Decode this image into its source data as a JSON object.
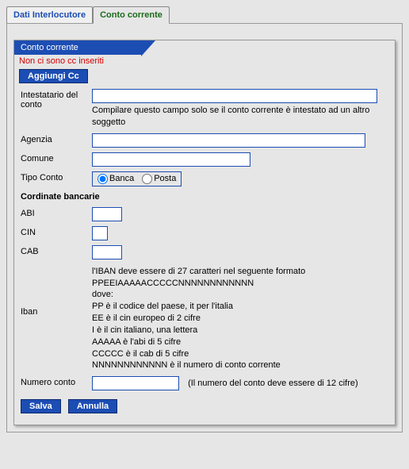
{
  "tabs": {
    "inactive": "Dati Interlocutore",
    "active": "Conto corrente"
  },
  "section": {
    "title": "Conto corrente"
  },
  "error": "Non ci sono cc inseriti",
  "buttons": {
    "add": "Aggiungi Cc",
    "save": "Salva",
    "cancel": "Annulla"
  },
  "form": {
    "intestatario": {
      "label": "Intestatario del conto",
      "value": "",
      "hint": "Compilare questo campo solo se il conto corrente è intestato ad un altro soggetto"
    },
    "agenzia": {
      "label": "Agenzia",
      "value": ""
    },
    "comune": {
      "label": "Comune",
      "value": ""
    },
    "tipoConto": {
      "label": "Tipo Conto",
      "options": {
        "banca": "Banca",
        "posta": "Posta"
      },
      "selected": "banca"
    },
    "coordinate": {
      "heading": "Cordinate bancarie"
    },
    "abi": {
      "label": "ABI",
      "value": ""
    },
    "cin": {
      "label": "CIN",
      "value": ""
    },
    "cab": {
      "label": "CAB",
      "value": ""
    },
    "iban": {
      "label": "Iban",
      "value": "",
      "hint": [
        "l'IBAN deve essere di 27 caratteri nel seguente formato",
        "PPEEIAAAAACCCCCNNNNNNNNNNNN",
        "dove:",
        "PP è il codice del paese, it per l'italia",
        "EE è il cin europeo di 2 cifre",
        "I è il cin italiano, una lettera",
        "AAAAA è l'abi di 5 cifre",
        "CCCCC è il cab di 5 cifre",
        "NNNNNNNNNNNN è il numero di conto corrente"
      ]
    },
    "numeroConto": {
      "label": "Numero conto",
      "value": "",
      "hint": "(Il numero del conto deve essere di 12 cifre)"
    }
  }
}
